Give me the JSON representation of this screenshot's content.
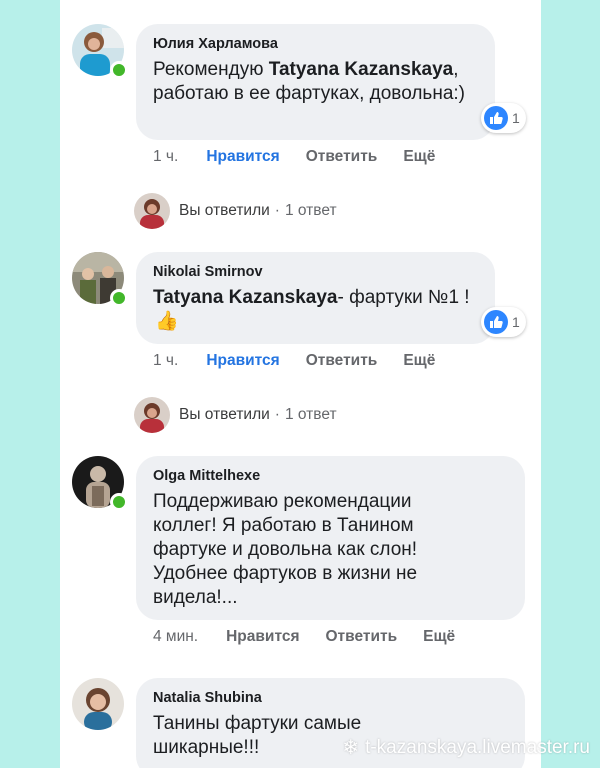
{
  "comments": [
    {
      "author": "Юлия Харламова",
      "text_before": "Рекомендую ",
      "mention": "Tatyana Kazanskaya",
      "text_after": ", работаю в ее фартуках, довольна:)",
      "reactions": "1",
      "time": "1 ч.",
      "like_label": "Нравится",
      "reply_label": "Ответить",
      "more_label": "Ещё",
      "reply_summary": {
        "label": "Вы ответили",
        "count": "1 ответ"
      }
    },
    {
      "author": "Nikolai Smirnov",
      "mention": "Tatyana Kazanskaya",
      "text_after": "- фартуки №1 !",
      "emoji": "👍",
      "reactions": "1",
      "time": "1 ч.",
      "like_label": "Нравится",
      "reply_label": "Ответить",
      "more_label": "Ещё",
      "reply_summary": {
        "label": "Вы ответили",
        "count": "1 ответ"
      }
    },
    {
      "author": "Olga Mittelhexe",
      "text": "Поддерживаю рекомендации коллег! Я работаю в Танином фартуке и довольна как слон! Удобнее фартуков в жизни не видела!...",
      "time": "4 мин.",
      "like_label": "Нравится",
      "reply_label": "Ответить",
      "more_label": "Ещё"
    },
    {
      "author": "Natalia Shubina",
      "text": "Танины фартуки самые шикарные!!!"
    }
  ],
  "separator": "·",
  "watermark": "t-kazanskaya.livemaster.ru",
  "colors": {
    "background": "#b7f0ea",
    "bubble": "#eef0f3",
    "like_active": "#2374e1",
    "online": "#42b72a",
    "reaction_like": "#2d86ff"
  },
  "icons": [
    "like-reaction-icon",
    "online-status-icon",
    "snowflake-icon"
  ]
}
